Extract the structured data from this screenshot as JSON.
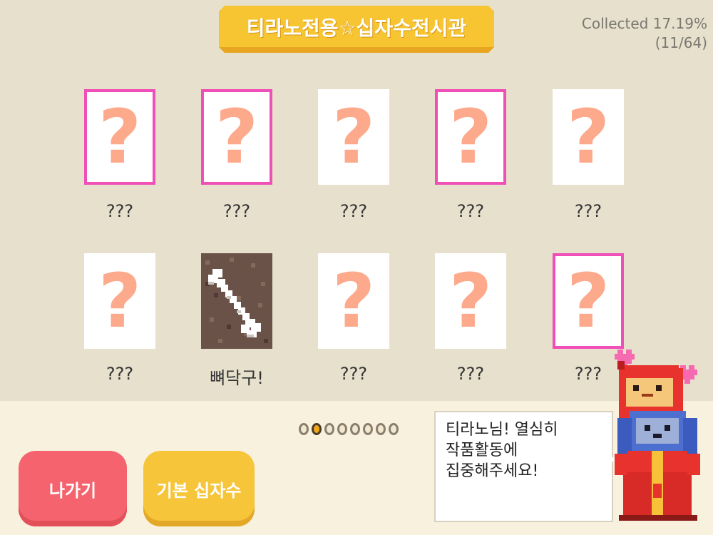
{
  "header": {
    "title": "티라노전용☆십자수전시관",
    "collected_line": "Collected 17.19%",
    "count_line": "(11/64)"
  },
  "items": [
    {
      "name": "???",
      "unlocked": false,
      "new": true,
      "icon": "question-mark"
    },
    {
      "name": "???",
      "unlocked": false,
      "new": true,
      "icon": "question-mark"
    },
    {
      "name": "???",
      "unlocked": false,
      "new": false,
      "icon": "question-mark"
    },
    {
      "name": "???",
      "unlocked": false,
      "new": true,
      "icon": "question-mark"
    },
    {
      "name": "???",
      "unlocked": false,
      "new": false,
      "icon": "question-mark"
    },
    {
      "name": "???",
      "unlocked": false,
      "new": false,
      "icon": "question-mark"
    },
    {
      "name": "뼈닥구!",
      "unlocked": true,
      "new": false,
      "icon": "bone"
    },
    {
      "name": "???",
      "unlocked": false,
      "new": false,
      "icon": "question-mark"
    },
    {
      "name": "???",
      "unlocked": false,
      "new": false,
      "icon": "question-mark"
    },
    {
      "name": "???",
      "unlocked": false,
      "new": true,
      "icon": "question-mark"
    }
  ],
  "pager": {
    "total": 8,
    "current": 2
  },
  "buttons": {
    "exit_label": "나가기",
    "basic_label": "기본 십자수"
  },
  "speech": {
    "line1": "티라노님! 열심히",
    "line2": "작품활동에",
    "line3": "집중해주세요!"
  },
  "colors": {
    "highlight": "#ef4fb6",
    "question": "#fda98b",
    "banner": "#f7c531"
  }
}
